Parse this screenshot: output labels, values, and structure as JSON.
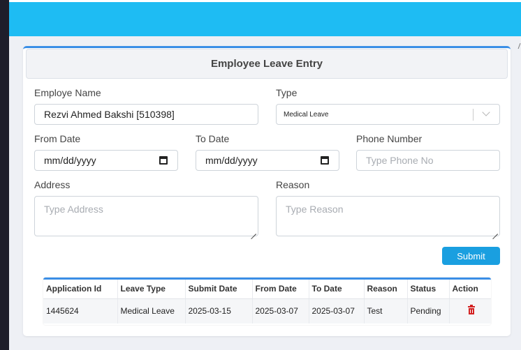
{
  "form": {
    "title": "Employee Leave Entry",
    "employee_label": "Employe Name",
    "employee_value": "Rezvi Ahmed Bakshi [510398]",
    "type_label": "Type",
    "type_value": "Medical Leave",
    "from_label": "From Date",
    "from_placeholder": "mm/dd/yyyy",
    "to_label": "To Date",
    "to_placeholder": "mm/dd/yyyy",
    "phone_label": "Phone Number",
    "phone_placeholder": "Type Phone No",
    "address_label": "Address",
    "address_placeholder": "Type Address",
    "reason_label": "Reason",
    "reason_placeholder": "Type Reason",
    "submit_label": "Submit"
  },
  "table": {
    "headers": [
      "Application Id",
      "Leave Type",
      "Submit Date",
      "From Date",
      "To Date",
      "Reason",
      "Status",
      "Action"
    ],
    "rows": [
      [
        "1445624",
        "Medical Leave",
        "2025-03-15",
        "2025-03-07",
        "2025-03-07",
        "Test",
        "Pending"
      ]
    ],
    "action_icon": "trash-icon"
  },
  "colors": {
    "topbar": "#1ebcf3",
    "accent": "#3a8ee6",
    "submit": "#1a9fe0",
    "delete": "#d32222"
  }
}
